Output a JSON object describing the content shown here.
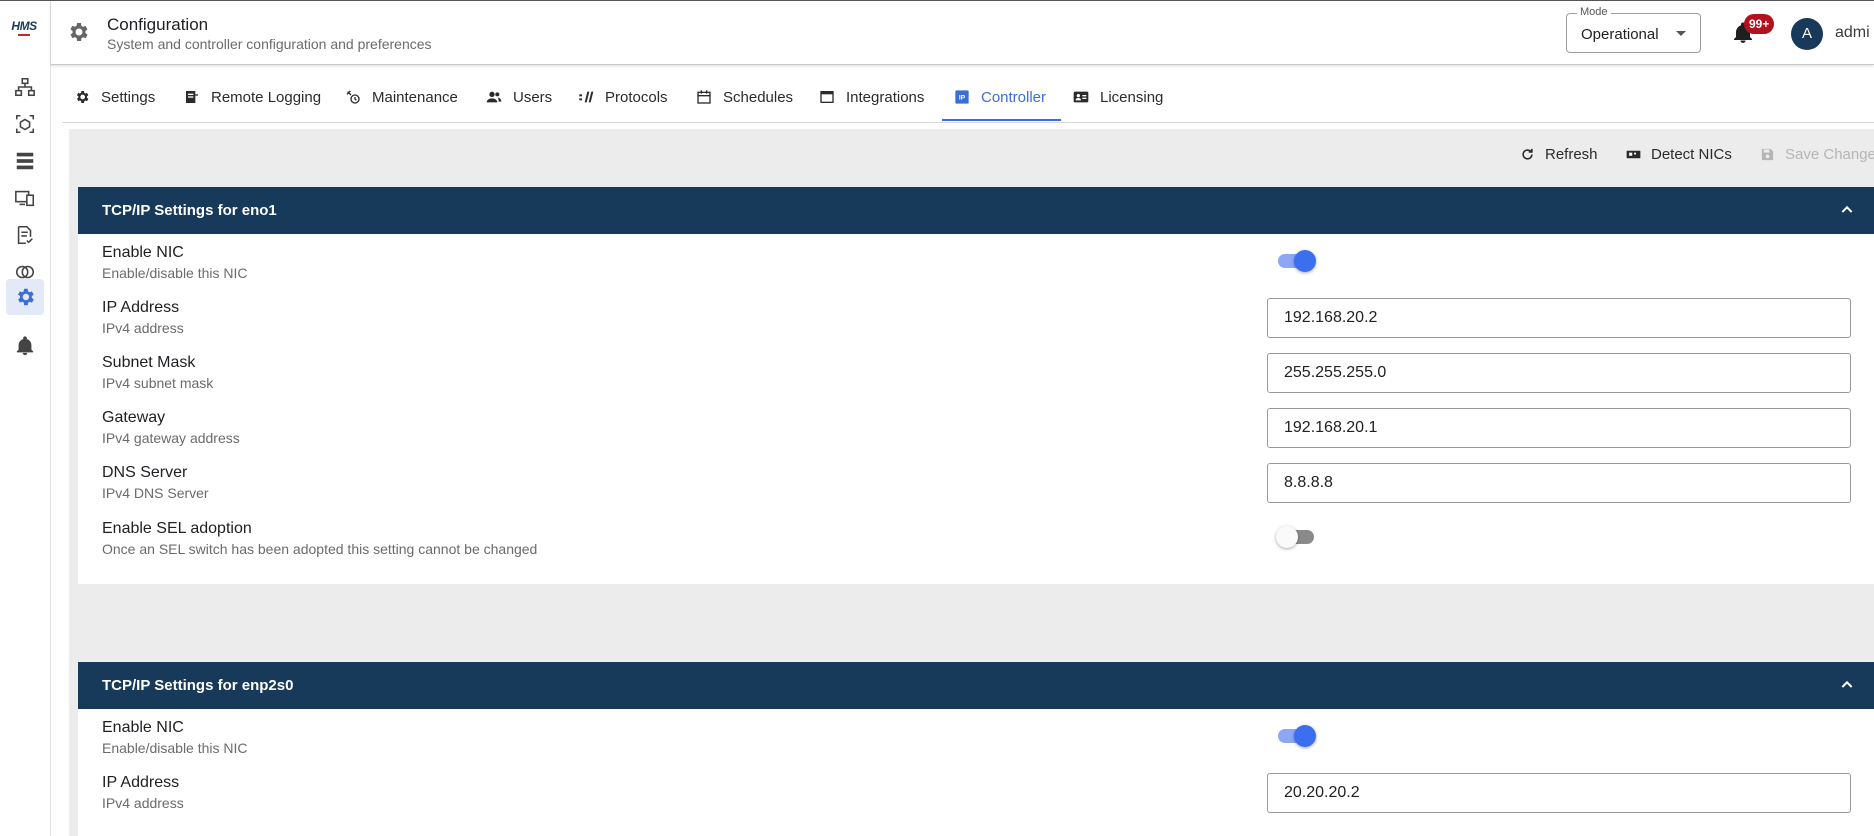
{
  "app": {
    "logo_text": "HMS"
  },
  "header": {
    "title": "Configuration",
    "subtitle": "System and controller configuration and preferences",
    "mode": {
      "legend": "Mode",
      "value": "Operational"
    },
    "notifications_badge": "99+",
    "avatar_initial": "A",
    "username": "admi"
  },
  "sidebar": {
    "items": [
      {
        "icon": "network-topology-icon"
      },
      {
        "icon": "cube-scan-icon"
      },
      {
        "icon": "server-rack-icon"
      },
      {
        "icon": "devices-icon"
      },
      {
        "icon": "document-check-icon"
      },
      {
        "icon": "rings-icon"
      },
      {
        "icon": "gear-icon",
        "active": true
      },
      {
        "icon": "bell-icon"
      }
    ]
  },
  "tabs": [
    {
      "label": "Settings",
      "icon": "gear-icon"
    },
    {
      "label": "Remote Logging",
      "icon": "log-icon"
    },
    {
      "label": "Maintenance",
      "icon": "maintenance-icon"
    },
    {
      "label": "Users",
      "icon": "users-icon"
    },
    {
      "label": "Protocols",
      "icon": "protocols-icon"
    },
    {
      "label": "Schedules",
      "icon": "calendar-icon"
    },
    {
      "label": "Integrations",
      "icon": "window-icon"
    },
    {
      "label": "Controller",
      "icon": "ip-icon",
      "active": true
    },
    {
      "label": "Licensing",
      "icon": "license-card-icon"
    }
  ],
  "toolbar": {
    "refresh_label": "Refresh",
    "detect_label": "Detect NICs",
    "save_label": "Save Changes"
  },
  "sections": [
    {
      "title": "TCP/IP Settings for eno1",
      "enable_nic": {
        "label": "Enable NIC",
        "desc": "Enable/disable this NIC",
        "on": true
      },
      "ip": {
        "label": "IP Address",
        "desc": "IPv4 address",
        "value": "192.168.20.2"
      },
      "subnet": {
        "label": "Subnet Mask",
        "desc": "IPv4 subnet mask",
        "value": "255.255.255.0"
      },
      "gateway": {
        "label": "Gateway",
        "desc": "IPv4 gateway address",
        "value": "192.168.20.1"
      },
      "dns": {
        "label": "DNS Server",
        "desc": "IPv4 DNS Server",
        "value": "8.8.8.8"
      },
      "sel": {
        "label": "Enable SEL adoption",
        "desc": "Once an SEL switch has been adopted this setting cannot be changed",
        "on": false
      }
    },
    {
      "title": "TCP/IP Settings for enp2s0",
      "enable_nic": {
        "label": "Enable NIC",
        "desc": "Enable/disable this NIC",
        "on": true
      },
      "ip": {
        "label": "IP Address",
        "desc": "IPv4 address",
        "value": "20.20.20.2"
      }
    }
  ],
  "colors": {
    "accent": "#3b6fd8",
    "section_header": "#17395a",
    "badge": "#b3111f",
    "toggle_on": "#3b6ff0"
  }
}
